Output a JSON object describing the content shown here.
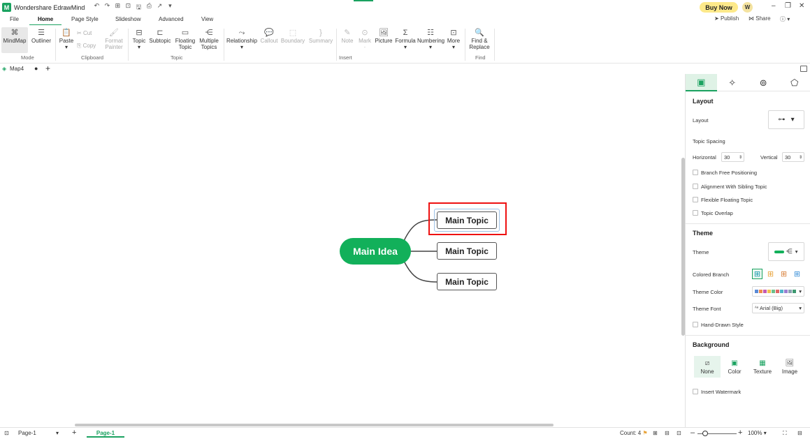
{
  "app": {
    "title": "Wondershare EdrawMind",
    "logo_glyph": "M",
    "buy_now": "Buy Now",
    "avatar_letter": "W",
    "quick_access": [
      "↶",
      "↷",
      "⊞",
      "⊡",
      "🖫",
      "⎙",
      "↗",
      "▾"
    ],
    "window_controls": [
      "–",
      "❐",
      "✕"
    ]
  },
  "menu": {
    "file": "File",
    "home": "Home",
    "page_style": "Page Style",
    "slideshow": "Slideshow",
    "advanced": "Advanced",
    "view": "View",
    "publish": "Publish",
    "share": "Share",
    "help": "?"
  },
  "ribbon": {
    "mindmap": "MindMap",
    "outliner": "Outliner",
    "mode_group": "Mode",
    "paste": "Paste",
    "cut": "Cut",
    "copy": "Copy",
    "format": "Format",
    "painter": "Painter",
    "clipboard_group": "Clipboard",
    "topic": "Topic",
    "subtopic": "Subtopic",
    "floating": "Floating",
    "floating2": "Topic",
    "multiple": "Multiple",
    "multiple2": "Topics",
    "topic_group": "Topic",
    "relationship": "Relationship",
    "callout": "Callout",
    "boundary": "Boundary",
    "summary": "Summary",
    "note": "Note",
    "mark": "Mark",
    "picture": "Picture",
    "formula": "Formula",
    "numbering": "Numbering",
    "more": "More",
    "insert_group": "Insert",
    "find": "Find &",
    "replace": "Replace",
    "find_group": "Find"
  },
  "tabs": {
    "doc_name": "Map4"
  },
  "mindmap": {
    "central": "Main Idea",
    "topics": [
      "Main Topic",
      "Main Topic",
      "Main Topic"
    ],
    "central_color": "#12b05a"
  },
  "panel": {
    "layout_head": "Layout",
    "layout_label": "Layout",
    "topic_spacing": "Topic Spacing",
    "horizontal": "Horizontal",
    "horizontal_val": "30",
    "vertical": "Vertical",
    "vertical_val": "30",
    "opts": [
      "Branch Free Positioning",
      "Alignment With Sibling Topic",
      "Flexible Floating Topic",
      "Topic Overlap"
    ],
    "theme_head": "Theme",
    "theme_label": "Theme",
    "colored_branch": "Colored Branch",
    "theme_color": "Theme Color",
    "theme_font": "Theme Font",
    "theme_font_val": "Arial (Big)",
    "hand_drawn": "Hand-Drawn Style",
    "bg_head": "Background",
    "bg_none": "None",
    "bg_color": "Color",
    "bg_texture": "Texture",
    "bg_image": "Image",
    "watermark": "Insert Watermark",
    "theme_swatches": [
      "#5b8bd6",
      "#f08a4b",
      "#c45ab3",
      "#f2c14e",
      "#6cc08b",
      "#e06666",
      "#4fb3c9",
      "#9b7fd1",
      "#8aa0b0",
      "#3d9970"
    ]
  },
  "status": {
    "page_select": "Page-1",
    "page_tab": "Page-1",
    "count": "Count: 4",
    "zoom": "100%"
  }
}
